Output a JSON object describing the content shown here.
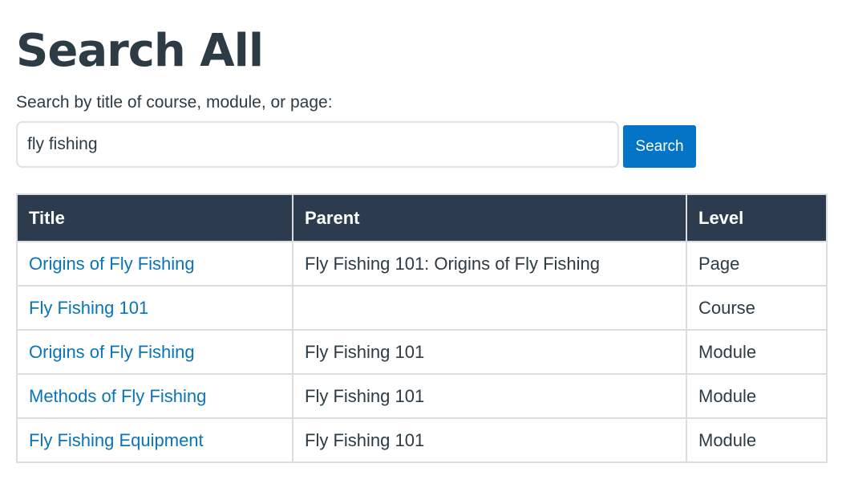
{
  "page": {
    "title": "Search All",
    "search_label": "Search by title of course, module, or page:"
  },
  "search": {
    "value": "fly fishing",
    "placeholder": "",
    "button_label": "Search"
  },
  "table": {
    "headers": {
      "title": "Title",
      "parent": "Parent",
      "level": "Level"
    },
    "rows": [
      {
        "title": "Origins of Fly Fishing",
        "parent": "Fly Fishing 101: Origins of Fly Fishing",
        "level": "Page"
      },
      {
        "title": "Fly Fishing 101",
        "parent": "",
        "level": "Course"
      },
      {
        "title": "Origins of Fly Fishing",
        "parent": "Fly Fishing 101",
        "level": "Module"
      },
      {
        "title": "Methods of Fly Fishing",
        "parent": "Fly Fishing 101",
        "level": "Module"
      },
      {
        "title": "Fly Fishing Equipment",
        "parent": "Fly Fishing 101",
        "level": "Module"
      }
    ]
  },
  "colors": {
    "header_bg": "#2d3b4f",
    "link": "#0a74b8",
    "button": "#0374c6",
    "text": "#2d3b45"
  }
}
